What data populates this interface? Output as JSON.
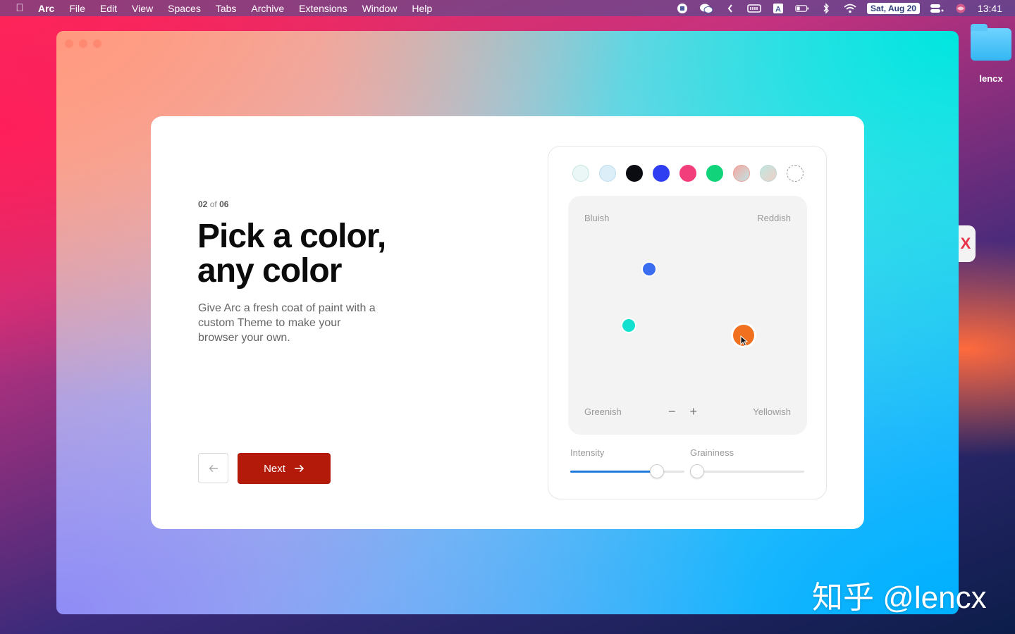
{
  "menubar": {
    "app": "Arc",
    "items": [
      "File",
      "Edit",
      "View",
      "Spaces",
      "Tabs",
      "Archive",
      "Extensions",
      "Window",
      "Help"
    ],
    "date": "Sat, Aug 20",
    "time": "13:41"
  },
  "desktop": {
    "folder_label": "lencx"
  },
  "onboarding": {
    "step_current": "02",
    "step_of": "of",
    "step_total": "06",
    "headline_line1": "Pick a color,",
    "headline_line2": "any color",
    "description": "Give Arc a fresh coat of paint with a custom Theme to make your browser your own.",
    "next_label": "Next"
  },
  "theme_picker": {
    "swatches": [
      {
        "color": "#eaf7f6",
        "border": "#c9e6e3"
      },
      {
        "color": "#dceff9",
        "border": "#bfdcec"
      },
      {
        "color": "#0b0b12",
        "border": "#0b0b12"
      },
      {
        "color": "#2f3ef0",
        "border": "#2f3ef0"
      },
      {
        "color": "#f23e7a",
        "border": "#f23e7a"
      },
      {
        "color": "#10d37a",
        "border": "#10d37a"
      },
      {
        "color": "#f0b0a8",
        "border": "#e7a59d"
      },
      {
        "color": "#cfe3e0",
        "border": "#c2d7d4"
      },
      {
        "color": "#ffffff",
        "border": "#9a9a9a"
      }
    ],
    "labels": {
      "top_left": "Bluish",
      "top_right": "Reddish",
      "bottom_left": "Greenish",
      "bottom_right": "Yellowish"
    },
    "points": [
      {
        "color": "#3b6df0"
      },
      {
        "color": "#14e0d0"
      },
      {
        "color": "#f07020"
      }
    ],
    "minus": "−",
    "plus": "+",
    "intensity_label": "Intensity",
    "intensity_value": 0.76,
    "graininess_label": "Graininess",
    "graininess_value": 0.0
  },
  "watermark": "知乎 @lencx"
}
